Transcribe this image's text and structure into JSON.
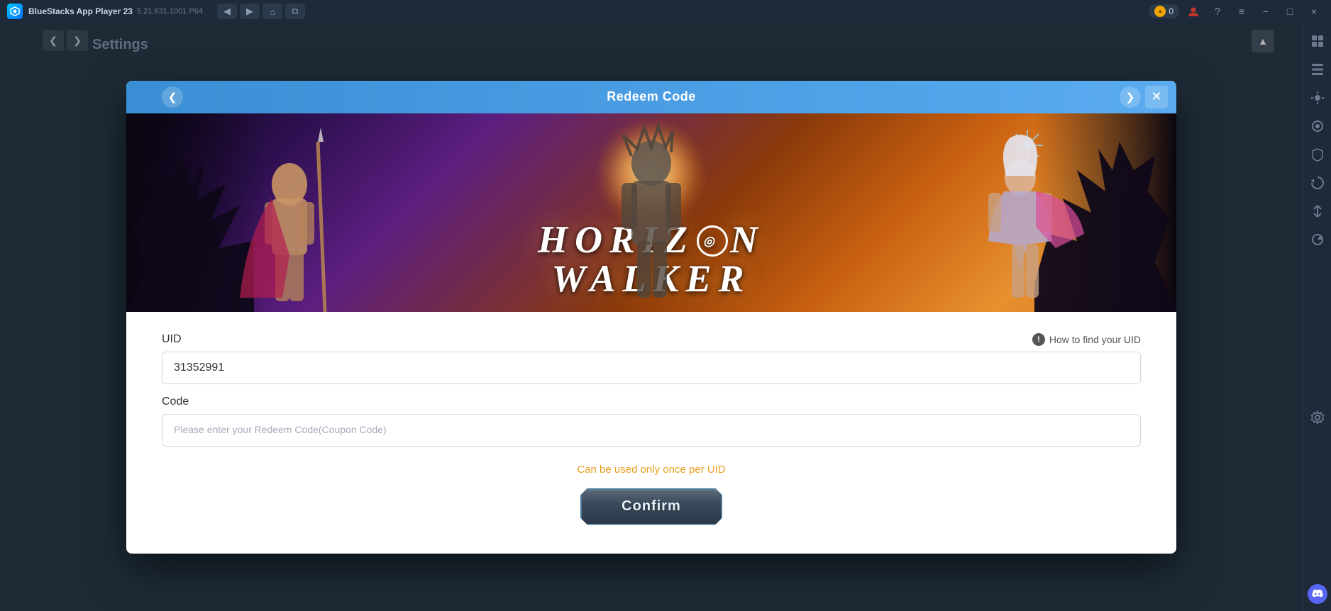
{
  "app": {
    "name": "BlueStacks App Player 23",
    "version": "5.21.631.1001 P64",
    "coin_count": "0"
  },
  "titlebar": {
    "back_label": "◀",
    "forward_label": "▶",
    "home_label": "⌂",
    "copy_label": "⧉",
    "settings_label": "Settings",
    "coin_label": "0",
    "help_label": "?",
    "menu_label": "≡",
    "minimize_label": "−",
    "maximize_label": "□",
    "close_label": "×"
  },
  "modal": {
    "title": "Redeem Code",
    "close_label": "✕",
    "nav_prev_label": "❮",
    "nav_next_label": "❯"
  },
  "game": {
    "title_line1": "HORIZ♾N",
    "title_line2": "WALKER"
  },
  "form": {
    "uid_label": "UID",
    "uid_value": "31352991",
    "how_to_find_label": "How to find your UID",
    "code_label": "Code",
    "code_placeholder": "Please enter your Redeem Code(Coupon Code)",
    "uid_note": "Can be used only once per UID",
    "confirm_label": "Confirm"
  },
  "sidebar": {
    "icons": [
      "⊞",
      "📋",
      "☀",
      "⚙",
      "📋",
      "↺",
      "↕",
      "⚙"
    ]
  }
}
